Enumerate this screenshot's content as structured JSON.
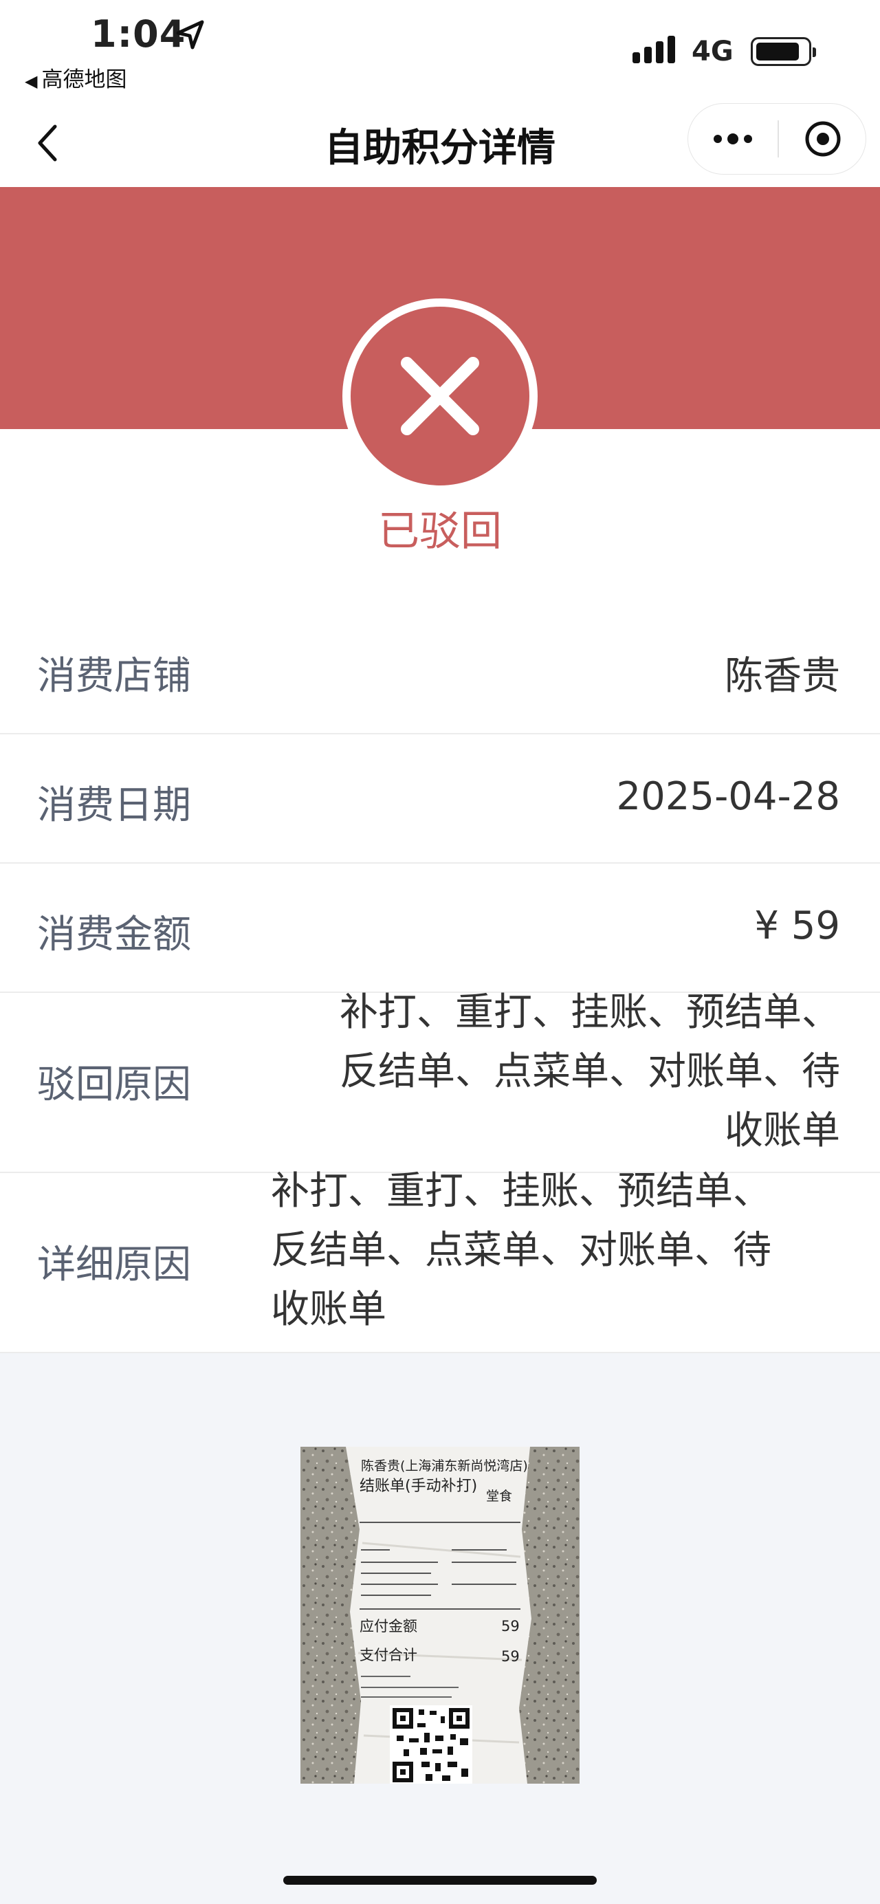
{
  "status_bar": {
    "time": "1:04",
    "back_app": "高德地图",
    "network": "4G"
  },
  "nav": {
    "title": "自助积分详情",
    "back_icon": "chevron-left-icon",
    "more_icon": "more-dots-icon",
    "close_icon": "target-close-icon"
  },
  "status": {
    "text": "已驳回",
    "icon": "x-circle-icon",
    "color": "#c85e5d"
  },
  "details": {
    "store_label": "消费店铺",
    "store_value": "陈香贵",
    "date_label": "消费日期",
    "date_value": "2025-04-28",
    "amount_label": "消费金额",
    "amount_value": "¥ 59",
    "reject_label": "驳回原因",
    "reject_lines": [
      "补打、重打、挂账、预结单、",
      "反结单、点菜单、对账单、待",
      "收账单"
    ],
    "detail_label": "详细原因",
    "detail_lines": [
      "补打、重打、挂账、预结单、",
      "反结单、点菜单、对账单、待",
      "收账单"
    ]
  },
  "receipt": {
    "shop": "陈香贵(上海浦东新尚悦湾店)",
    "title": "结账单(手动补打)",
    "tag": "堂食",
    "amount_due_label": "应付金额",
    "amount_due": "59",
    "paid_label": "支付合计",
    "paid": "59"
  }
}
